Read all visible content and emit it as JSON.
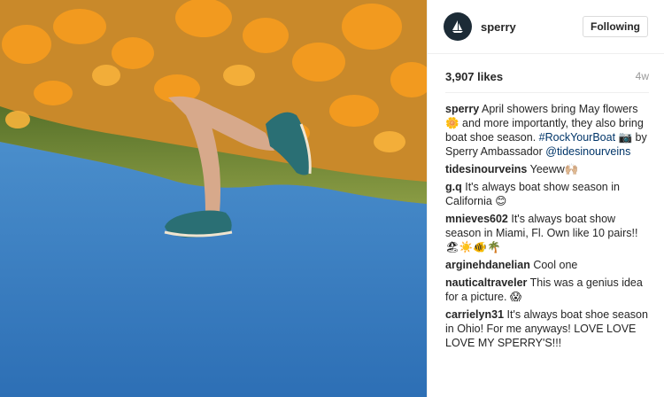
{
  "account": {
    "username": "sperry"
  },
  "follow_button": {
    "label": "Following"
  },
  "post": {
    "likes": "3,907 likes",
    "time": "4w"
  },
  "caption": {
    "user": "sperry",
    "text_1": " April showers bring May flowers 🌼 and more importantly, they also bring boat shoe season. ",
    "hashtag": "#RockYourBoat",
    "text_2": " 📷 by Sperry Ambassador ",
    "mention": "@tidesinourveins"
  },
  "comments": [
    {
      "user": "tidesinourveins",
      "text": " Yeeww🙌🏼"
    },
    {
      "user": "g.q",
      "text": " It's always boat show season in California 😊"
    },
    {
      "user": "mnieves602",
      "text": " It's always boat show season in Miami, Fl. Own like 10 pairs!! 🏖☀️🐠🌴"
    },
    {
      "user": "arginehdanelian",
      "text": " Cool one"
    },
    {
      "user": "nauticaltraveler",
      "text": " This was a genius idea for a picture. 😱"
    },
    {
      "user": "carrielyn31",
      "text": " It's always boat shoe season in Ohio! For me anyways! LOVE LOVE LOVE MY SPERRY'S!!!"
    }
  ],
  "colors": {
    "sky_top": "#2d6fb5",
    "sky_bottom": "#5a9fd8",
    "flowers": "#f29a1f",
    "shoe": "#2a6f74"
  },
  "icons": {
    "avatar": "sperry-sailboat-logo"
  }
}
